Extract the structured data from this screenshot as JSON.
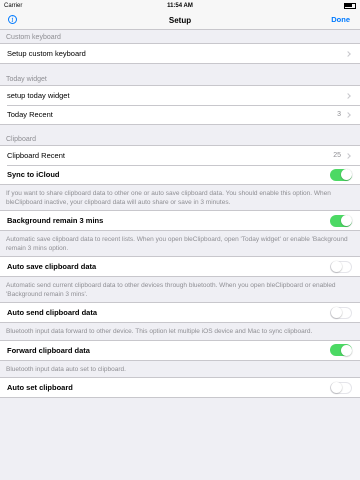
{
  "status_bar": {
    "carrier": "Carrier",
    "time": "11:54 AM"
  },
  "nav": {
    "title": "Setup",
    "done_label": "Done",
    "info_label": "i"
  },
  "custom_keyboard": {
    "header": "Custom keyboard",
    "setup_label": "Setup custom keyboard"
  },
  "today_widget": {
    "header": "Today widget",
    "setup_label": "setup today widget",
    "recent_label": "Today Recent",
    "recent_value": "3"
  },
  "clipboard": {
    "header": "Clipboard",
    "recent_label": "Clipboard Recent",
    "recent_value": "25",
    "sync_label": "Sync to iCloud",
    "sync_on": true
  },
  "background": {
    "description": "If you want to share clipboard data to other one or auto save clipboard data. You should enable this option. When bleClipboard inactive, your clipboard data will auto share or save in 3 minutes.",
    "label": "Background remain 3 mins",
    "on": true
  },
  "auto_save": {
    "description": "Automatic save clipboard data to recent lists. When you open bleClipboard, open 'Today widget' or  enable 'Background remain 3 mins option.",
    "label": "Auto save clipboard data",
    "on": false
  },
  "auto_send": {
    "description": "Automatic send current clipboard data to other devices through bluetooth. When you open bleClipboard or enabled 'Background remain 3 mins'.",
    "label": "Auto send clipboard data",
    "on": false
  },
  "forward": {
    "description": "Bluetooth input data forward to other device. This option let multiple iOS device and Mac to sync clipboard.",
    "label": "Forward clipboard data",
    "on": true
  },
  "auto_set": {
    "description": "Bluetooth input data auto set to clipboard.",
    "label": "Auto set clipboard",
    "on": false
  },
  "colors": {
    "accent": "#007aff",
    "toggle_on": "#4cd964",
    "background": "#efeff4"
  },
  "icons": [
    "info-icon",
    "chevron-right-icon",
    "battery-icon"
  ]
}
